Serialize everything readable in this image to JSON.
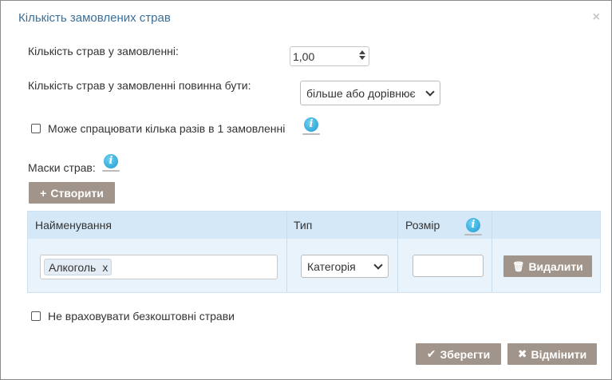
{
  "dialog": {
    "title": "Кількість замовлених страв",
    "close_glyph": "×"
  },
  "form": {
    "qty_label": "Кількість страв у замовленні:",
    "qty_value": "1,00",
    "condition_label": "Кількість страв у замовленні повинна бути:",
    "condition_value": "більше або дорівнює",
    "multi_label": "Може спрацювати кілька разів в 1 замовленні",
    "masks_label": "Маски страв:",
    "create_button": "Створити",
    "exclude_free_label": "Не враховувати безкоштовні страви"
  },
  "table": {
    "headers": {
      "name": "Найменування",
      "type": "Тип",
      "size": "Розмір"
    },
    "rows": [
      {
        "tag": "Алкоголь",
        "tag_remove": "x",
        "type": "Категорія",
        "size": "",
        "delete_button": "Видалити"
      }
    ]
  },
  "footer": {
    "save_button": "Зберегти",
    "cancel_button": "Відмінити"
  },
  "icons": {
    "info": "i",
    "plus": "+",
    "check": "✔",
    "cross": "✖",
    "trash": "🗑"
  },
  "colors": {
    "title": "#3a6f9a",
    "button": "#a1948a",
    "table_header": "#d5e8f7",
    "table_row": "#e9f3fb",
    "info_icon": "#1d9bd0"
  }
}
